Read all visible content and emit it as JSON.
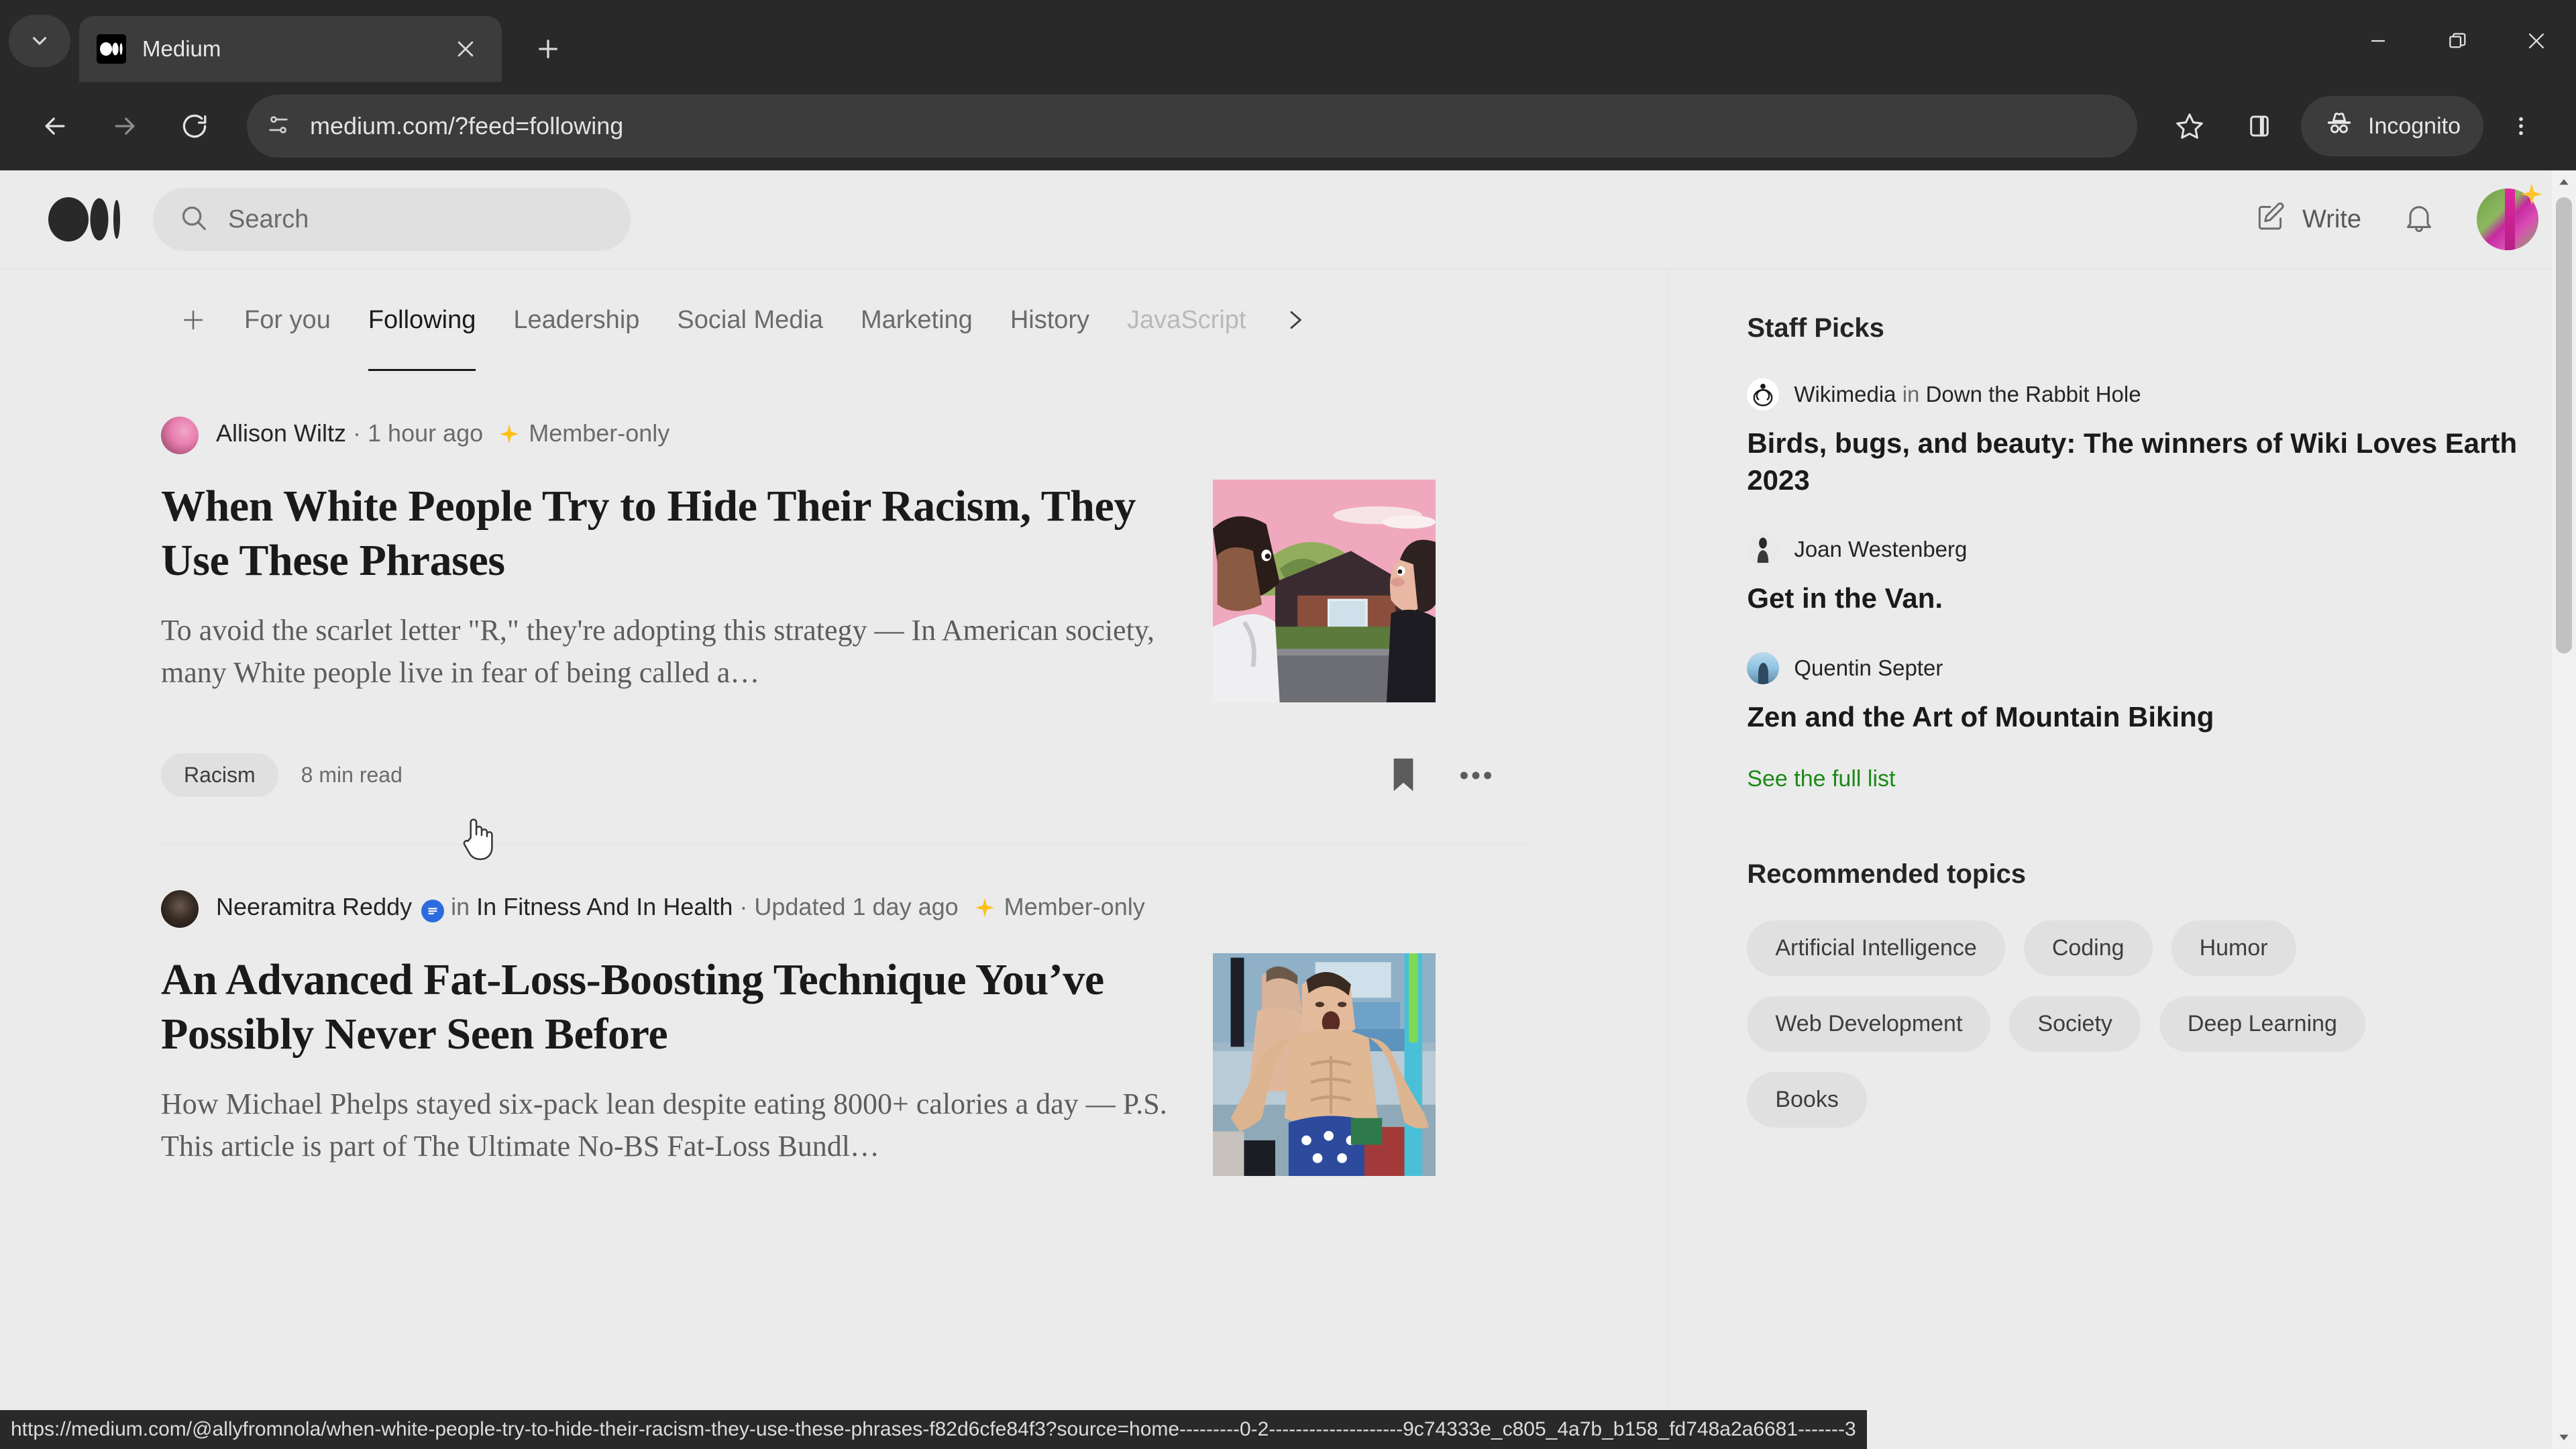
{
  "browser": {
    "tab": {
      "title": "Medium",
      "favicon_icon": "medium-favicon"
    },
    "tab_list_icon": "chevron-down-icon",
    "new_tab_icon": "plus-icon",
    "close_tab_icon": "close-icon",
    "window": {
      "minimize": "minimize-icon",
      "maximize": "restore-icon",
      "close": "close-icon"
    },
    "nav": {
      "back": "back-arrow-icon",
      "forward": "forward-arrow-icon",
      "reload": "reload-icon"
    },
    "omnibox": {
      "url": "medium.com/?feed=following",
      "site_info_icon": "site-settings-icon"
    },
    "actions": {
      "bookmark_icon": "star-icon",
      "sidepanel_icon": "side-panel-icon",
      "incognito_label": "Incognito",
      "incognito_icon": "incognito-hat-icon",
      "menu_icon": "three-dots-vertical-icon"
    },
    "statusbar_url": "https://medium.com/@allyfromnola/when-white-people-try-to-hide-their-racism-they-use-these-phrases-f82d6cfe84f3?source=home---------0-2--------------------9c74333e_c805_4a7b_b158_fd748a2a6681-------3"
  },
  "site": {
    "logo": "medium-logo",
    "search": {
      "placeholder": "Search",
      "icon": "search-icon",
      "value": ""
    },
    "write": {
      "label": "Write",
      "icon": "write-pencil-icon"
    },
    "notifications_icon": "bell-icon",
    "avatar": {
      "name": "user-avatar",
      "badge_icon": "star-sparkle-icon"
    }
  },
  "feed": {
    "add_tab_icon": "plus-icon",
    "next_tabs_icon": "chevron-right-icon",
    "tabs": [
      {
        "label": "For you",
        "active": false,
        "faded": false
      },
      {
        "label": "Following",
        "active": true,
        "faded": false
      },
      {
        "label": "Leadership",
        "active": false,
        "faded": false
      },
      {
        "label": "Social Media",
        "active": false,
        "faded": false
      },
      {
        "label": "Marketing",
        "active": false,
        "faded": false
      },
      {
        "label": "History",
        "active": false,
        "faded": false
      },
      {
        "label": "JavaScript",
        "active": false,
        "faded": true
      }
    ],
    "articles": [
      {
        "author": "Allison Wiltz",
        "publication": "",
        "separator": " · ",
        "time": "1 hour ago",
        "member_only": "Member-only",
        "star_icon": "member-star-icon",
        "title": "When White People Try to Hide Their Racism, They Use These Phrases",
        "excerpt": "To avoid the scarlet letter \"R,\" they're adopting this strategy — In American society, many White people live in fear of being called a…",
        "tag": "Racism",
        "read_time": "8 min read",
        "save_icon": "bookmark-icon",
        "more_icon": "ellipsis-icon",
        "thumbnail": "illustration-two-women-talking"
      },
      {
        "author": "Neeramitra Reddy",
        "publication_prefix": "in",
        "publication": "In Fitness And In Health",
        "publication_badge_icon": "publication-badge-icon",
        "separator": " · ",
        "time": "Updated 1 day ago",
        "member_only": "Member-only",
        "star_icon": "member-star-icon",
        "title": "An Advanced Fat-Loss-Boosting Technique You’ve Possibly Never Seen Before",
        "excerpt": "How Michael Phelps stayed six-pack lean despite eating 8000+ calories a day — P.S. This article is part of The Ultimate No-BS Fat-Loss Bundl…",
        "thumbnail": "photo-swimmer-celebrating"
      }
    ]
  },
  "sidebar": {
    "staff_picks": {
      "heading": "Staff Picks",
      "items": [
        {
          "author": "Wikimedia",
          "in_word": "in",
          "publication": "Down the Rabbit Hole",
          "avatar": "wikimedia-logo-icon",
          "title": "Birds, bugs, and beauty: The winners of Wiki Loves Earth 2023"
        },
        {
          "author": "Joan Westenberg",
          "in_word": "",
          "publication": "",
          "avatar": "joan-avatar",
          "title": "Get in the Van."
        },
        {
          "author": "Quentin Septer",
          "in_word": "",
          "publication": "",
          "avatar": "quentin-avatar",
          "title": "Zen and the Art of Mountain Biking"
        }
      ],
      "see_full_list": "See the full list"
    },
    "recommended_topics": {
      "heading": "Recommended topics",
      "topics": [
        "Artificial Intelligence",
        "Coding",
        "Humor",
        "Web Development",
        "Society",
        "Deep Learning",
        "Books"
      ]
    }
  },
  "colors": {
    "chrome_bg": "#292929",
    "chrome_surface": "#3c3c3c",
    "page_bg": "#ebebeb",
    "accent_green": "#1a8917",
    "text_primary": "#242424",
    "text_muted": "#6b6b6b",
    "star_gold": "#ffc017",
    "publication_blue": "#2b6bdd"
  }
}
